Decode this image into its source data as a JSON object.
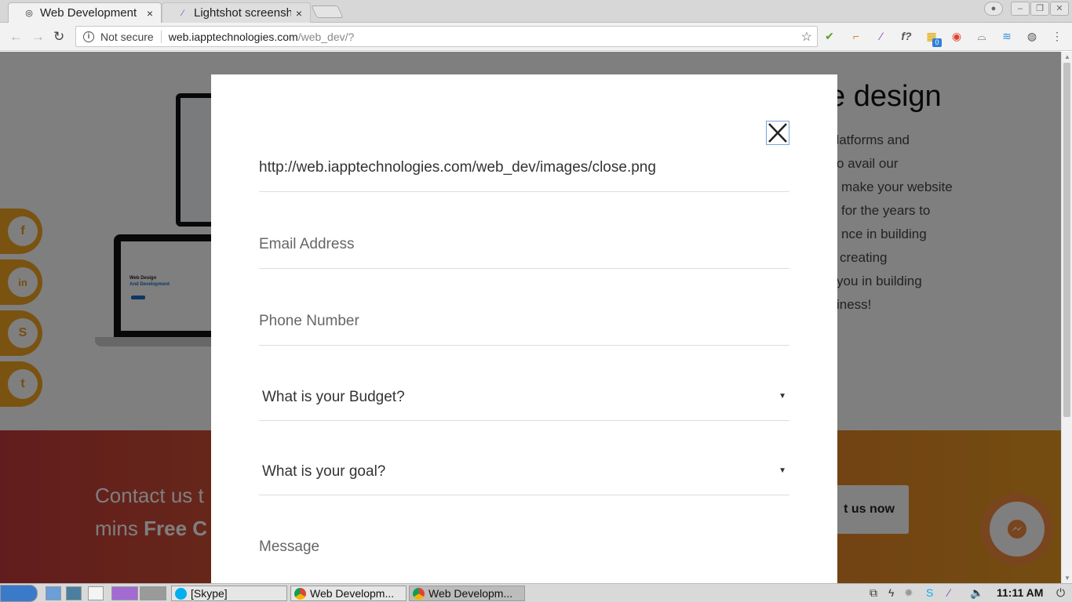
{
  "browser": {
    "tabs": [
      {
        "title": "Web Development",
        "close": "×"
      },
      {
        "title": "Lightshot screensh",
        "close": "×"
      }
    ],
    "address": {
      "security_label": "Not secure",
      "host": "web.iapptechnologies.com",
      "path": "/web_dev/?"
    },
    "extension_badge": "0"
  },
  "page": {
    "hero_title": "e design",
    "hero_lines": [
      "platforms and",
      "o avail our",
      "make your website",
      "for the years to",
      "nce in building",
      "creating",
      "you in building",
      "iness!"
    ],
    "laptop_title": "Web Design",
    "laptop_subtitle": "And Development",
    "cta": {
      "line1": "Contact us t",
      "line2_plain": "mins ",
      "line2_bold": "Free C",
      "button": "t us now"
    },
    "social": [
      {
        "glyph": "f",
        "icon": "facebook-icon"
      },
      {
        "glyph": "in",
        "icon": "linkedin-icon"
      },
      {
        "glyph": "S",
        "icon": "skype-icon"
      },
      {
        "glyph": "t",
        "icon": "twitter-icon"
      }
    ]
  },
  "modal": {
    "close_image_url_text": "http://web.iapptechnologies.com/web_dev/images/close.png",
    "email_placeholder": "Email Address",
    "phone_placeholder": "Phone Number",
    "budget_select": "What is your Budget?",
    "goal_select": "What is your goal?",
    "message_placeholder": "Message"
  },
  "taskbar": {
    "items": [
      "[Skype]",
      "Web Developm...",
      "Web Developm..."
    ],
    "clock": "11:11 AM"
  },
  "colors": {
    "accent_orange": "#f5a623",
    "band_start": "#c33a3a",
    "band_end": "#e99a22",
    "messenger": "#f28a3c"
  }
}
